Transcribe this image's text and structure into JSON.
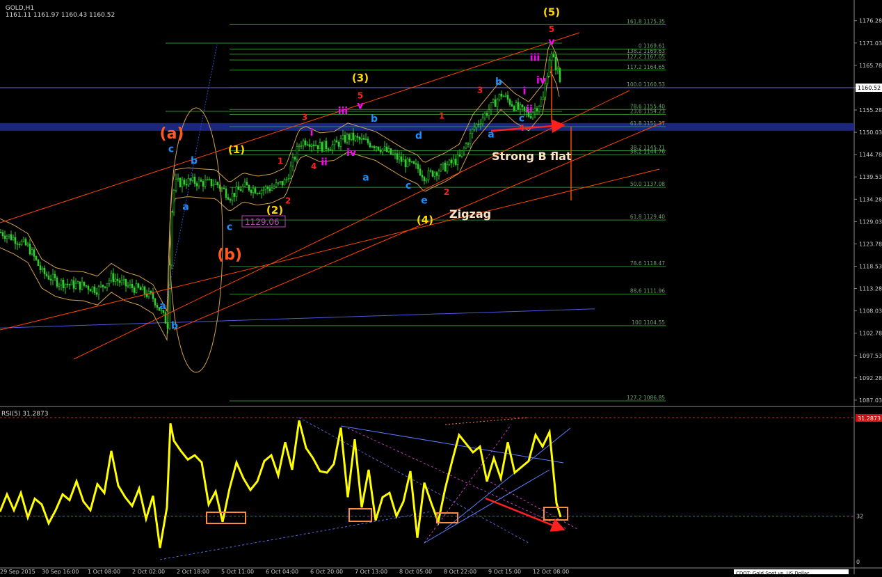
{
  "header": {
    "symbol": "GOLD,H1",
    "quote": "1161.11 1161.97 1160.43 1160.52"
  },
  "rsi_header": "RSI(5) 31.2873",
  "footer_text": "CDOT: Gold Spot vs. US Dollar",
  "colors": {
    "background": "#000000",
    "candle": "#32CD32",
    "fib_line": "#2E8B2E",
    "channel": "#FF4500",
    "bands": "#D2A050",
    "rsi": "#FFFF00",
    "box": "#FF8C40",
    "arrow": "#FF2020",
    "blue_zone": "#1E2A8C",
    "wave_red": "#FF2020",
    "wave_blue": "#1E90FF",
    "wave_magenta": "#FF00FF",
    "wave_yellow": "#FFD700",
    "wave_orange": "#FF5A1E",
    "annotation": "#FFE4C4"
  },
  "chart_data": [
    {
      "type": "candlestick",
      "title": "GOLD,H1",
      "ylim": [
        1086.85,
        1178.2
      ],
      "price_ticks": [
        "1176.28",
        "1171.03",
        "1165.78",
        "1160.52",
        "1155.28",
        "1150.03",
        "1144.78",
        "1139.53",
        "1134.28",
        "1129.03",
        "1123.78",
        "1118.53",
        "1113.28",
        "1108.03",
        "1102.78",
        "1097.53",
        "1092.28",
        "1087.03"
      ],
      "current_price": "1160.52",
      "fib_levels": [
        {
          "label": "161.8 1175.35",
          "price": 1175.35
        },
        {
          "label": "0 1169.61",
          "price": 1169.61
        },
        {
          "label": "138.2 1169.63",
          "price": 1168.4
        },
        {
          "label": "127.2 1167.05",
          "price": 1167.05
        },
        {
          "label": "117.2 1164.65",
          "price": 1164.65
        },
        {
          "label": "100.0 1160.53",
          "price": 1160.53
        },
        {
          "label": "78.6 1155.40",
          "price": 1155.4
        },
        {
          "label": "23.6 1154.23",
          "price": 1154.23
        },
        {
          "label": "61.8 1151.37",
          "price": 1151.37
        },
        {
          "label": "38.2 1145.71",
          "price": 1145.71
        },
        {
          "label": "38.2 1144.76",
          "price": 1144.76
        },
        {
          "label": "50.0 1137.08",
          "price": 1137.08
        },
        {
          "label": "61.8 1129.40",
          "price": 1129.4
        },
        {
          "label": "78.6 1118.47",
          "price": 1118.47
        },
        {
          "label": "88.6 1111.96",
          "price": 1111.96
        },
        {
          "label": "100 1104.55",
          "price": 1104.55
        },
        {
          "label": "127.2 1086.85",
          "price": 1086.85
        }
      ],
      "price_box_label": "1129.06",
      "annotations": [
        "Strong B flat",
        "Zigzag"
      ],
      "wave_labels": [
        {
          "text": "(5)",
          "color": "yellow",
          "price": 1177.5,
          "bar": 793
        },
        {
          "text": "5",
          "color": "red",
          "price": 1173.6,
          "bar": 793
        },
        {
          "text": "v",
          "color": "magenta",
          "price": 1170.6,
          "bar": 793
        },
        {
          "text": "iii",
          "color": "magenta",
          "price": 1166.8,
          "bar": 769
        },
        {
          "text": "iv",
          "color": "magenta",
          "price": 1161.5,
          "bar": 778
        },
        {
          "text": "i",
          "color": "magenta",
          "price": 1159,
          "bar": 754
        },
        {
          "text": "ii",
          "color": "magenta",
          "price": 1154.7,
          "bar": 761
        },
        {
          "text": "b",
          "color": "blue",
          "price": 1161.2,
          "bar": 717
        },
        {
          "text": "3",
          "color": "red",
          "price": 1159.3,
          "bar": 690
        },
        {
          "text": "c",
          "color": "blue",
          "price": 1152.6,
          "bar": 750
        },
        {
          "text": "a",
          "color": "blue",
          "price": 1148.8,
          "bar": 706
        },
        {
          "text": "4",
          "color": "red",
          "price": 1150.4,
          "bar": 750
        },
        {
          "text": "1",
          "color": "red",
          "price": 1153.2,
          "bar": 635
        },
        {
          "text": "2",
          "color": "red",
          "price": 1135.3,
          "bar": 642
        },
        {
          "text": "(3)",
          "color": "yellow",
          "price": 1162,
          "bar": 518
        },
        {
          "text": "5",
          "color": "red",
          "price": 1158,
          "bar": 518
        },
        {
          "text": "v",
          "color": "magenta",
          "price": 1155.6,
          "bar": 518
        },
        {
          "text": "iii",
          "color": "magenta",
          "price": 1154.3,
          "bar": 493
        },
        {
          "text": "b",
          "color": "blue",
          "price": 1152.5,
          "bar": 538
        },
        {
          "text": "3",
          "color": "red",
          "price": 1152.9,
          "bar": 438
        },
        {
          "text": "i",
          "color": "magenta",
          "price": 1149.2,
          "bar": 448
        },
        {
          "text": "iv",
          "color": "magenta",
          "price": 1144.5,
          "bar": 505
        },
        {
          "text": "ii",
          "color": "magenta",
          "price": 1142.3,
          "bar": 466
        },
        {
          "text": "1",
          "color": "red",
          "price": 1142.6,
          "bar": 403
        },
        {
          "text": "4",
          "color": "red",
          "price": 1141.4,
          "bar": 451
        },
        {
          "text": "d",
          "color": "blue",
          "price": 1148.5,
          "bar": 602
        },
        {
          "text": "a",
          "color": "blue",
          "price": 1138.7,
          "bar": 526
        },
        {
          "text": "c",
          "color": "blue",
          "price": 1136.8,
          "bar": 587
        },
        {
          "text": "e",
          "color": "blue",
          "price": 1133.3,
          "bar": 610
        },
        {
          "text": "(4)",
          "color": "yellow",
          "price": 1128.6,
          "bar": 611
        },
        {
          "text": "(1)",
          "color": "yellow",
          "price": 1145.1,
          "bar": 340
        },
        {
          "text": "(2)",
          "color": "yellow",
          "price": 1130.9,
          "bar": 395
        },
        {
          "text": "2",
          "color": "red",
          "price": 1133.3,
          "bar": 414
        },
        {
          "text": "c",
          "color": "blue",
          "price": 1145.4,
          "bar": 246
        },
        {
          "text": "b",
          "color": "blue",
          "price": 1142.6,
          "bar": 279
        },
        {
          "text": "a",
          "color": "blue",
          "price": 1131.8,
          "bar": 267
        },
        {
          "text": "c",
          "color": "blue",
          "price": 1127,
          "bar": 330
        },
        {
          "text": "a",
          "color": "blue",
          "price": 1108.5,
          "bar": 234
        },
        {
          "text": "b",
          "color": "blue",
          "price": 1103.8,
          "bar": 251
        },
        {
          "text": "(a)",
          "color": "orange",
          "price": 1148.6,
          "bar": 247
        },
        {
          "text": "(b)",
          "color": "orange",
          "price": 1120.1,
          "bar": 330
        }
      ],
      "series": [
        {
          "name": "price",
          "x": [
            0,
            20,
            40,
            60,
            80,
            100,
            120,
            140,
            160,
            180,
            200,
            220,
            240,
            245,
            250,
            270,
            290,
            310,
            330,
            350,
            370,
            390,
            410,
            430,
            440,
            460,
            480,
            500,
            520,
            540,
            560,
            580,
            600,
            610,
            620,
            640,
            660,
            680,
            700,
            720,
            740,
            760,
            780,
            790,
            800,
            806
          ],
          "y": [
            1126.5,
            1125,
            1123,
            1117,
            1115,
            1114.2,
            1114,
            1113,
            1116,
            1114,
            1113,
            1111,
            1104.8,
            1130,
            1138,
            1138.5,
            1138.2,
            1138,
            1135,
            1137.3,
            1136.5,
            1137,
            1138.5,
            1147.5,
            1148.2,
            1146.7,
            1147,
            1149,
            1148,
            1147,
            1145,
            1143,
            1141.5,
            1139.6,
            1140.5,
            1142,
            1144,
            1151,
            1155,
            1159,
            1156,
            1154,
            1158,
            1168.6,
            1165,
            1160.5
          ]
        }
      ]
    },
    {
      "type": "line",
      "title": "RSI(5) 31.2873",
      "ylim": [
        0,
        100
      ],
      "level_labels": [
        "31.2873",
        "32",
        "0"
      ],
      "series": [
        {
          "name": "RSI(5)",
          "x": [
            0,
            10,
            20,
            30,
            40,
            50,
            60,
            70,
            80,
            90,
            100,
            110,
            120,
            130,
            140,
            150,
            160,
            170,
            180,
            190,
            200,
            210,
            220,
            230,
            240,
            245,
            250,
            260,
            270,
            280,
            290,
            300,
            310,
            320,
            330,
            340,
            350,
            360,
            370,
            380,
            390,
            400,
            410,
            420,
            430,
            440,
            450,
            460,
            470,
            480,
            490,
            500,
            510,
            520,
            530,
            540,
            550,
            560,
            570,
            580,
            590,
            600,
            610,
            620,
            630,
            640,
            650,
            660,
            670,
            680,
            690,
            700,
            710,
            720,
            730,
            740,
            750,
            760,
            770,
            780,
            790,
            800,
            806
          ],
          "y": [
            35,
            47,
            36,
            48,
            31,
            44,
            40,
            27,
            36,
            47,
            43,
            56,
            42,
            36,
            54,
            48,
            77,
            53,
            45,
            39,
            51,
            30,
            46,
            10,
            38,
            96,
            84,
            77,
            71,
            74,
            69,
            40,
            49,
            28,
            51,
            69,
            58,
            50,
            56,
            70,
            74,
            60,
            83,
            64,
            98,
            79,
            72,
            63,
            62,
            68,
            93,
            45,
            85,
            38,
            64,
            29,
            45,
            48,
            32,
            42,
            63,
            17,
            55,
            41,
            28,
            51,
            70,
            88,
            82,
            76,
            80,
            56,
            72,
            58,
            83,
            62,
            66,
            70,
            88,
            80,
            90,
            41,
            31.3
          ]
        }
      ]
    }
  ]
}
